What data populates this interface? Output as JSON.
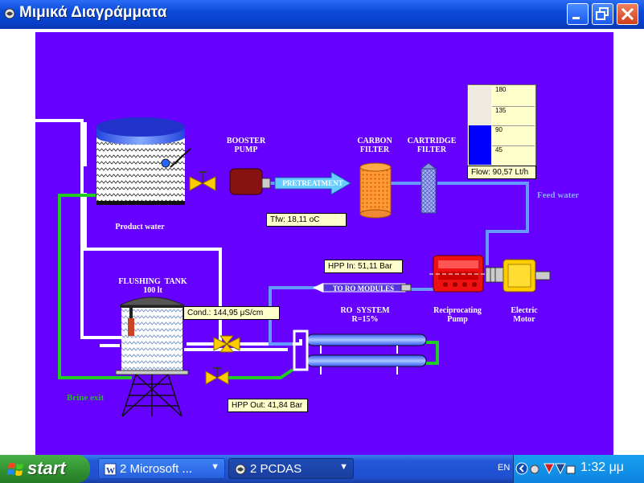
{
  "window": {
    "title": "Μιμικά Διαγράμματα"
  },
  "diagram": {
    "booster_pump": "BOOSTER\nPUMP",
    "pretreatment": "PRETREATMENT",
    "carbon_filter": "CARBON\nFILTER",
    "cartridge_filter": "CARTRIDGE\nFILTER",
    "product_water": "Product water",
    "feed_water": "Feed water",
    "flushing_tank": "FLUSHING  TANK\n100 lt",
    "to_ro_modules": "TO RO MODULES",
    "ro_system": "RO  SYSTEM\nR=15%",
    "reciprocating_pump": "Reciprocating\nPump",
    "electric_motor": "Electric\nMotor",
    "brine_exit": "Brine exit"
  },
  "readouts": {
    "tfw": "Tfw: 18,11 oC",
    "hpp_in": "HPP In: 51,11 Bar",
    "conductivity": "Cond.: 144,95 μS/cm",
    "hpp_out": "HPP Out: 41,84 Bar",
    "flow": "Flow: 90,57 Lt/h"
  },
  "flow_gauge": {
    "ticks": [
      "180",
      "135",
      "90",
      "45"
    ],
    "min": 0,
    "max": 180,
    "value": 90.57
  },
  "taskbar": {
    "start_label": "start",
    "tasks": [
      {
        "label": "2 Microsoft ..."
      },
      {
        "label": "2 PCDAS"
      }
    ],
    "language": "EN",
    "clock": "1:32 μμ"
  },
  "colors": {
    "background": "#6600ff",
    "pipe_white": "#ffffff",
    "pipe_blue": "#6699ff",
    "pipe_green": "#22cc22",
    "gauge_fill": "#0000ff"
  }
}
